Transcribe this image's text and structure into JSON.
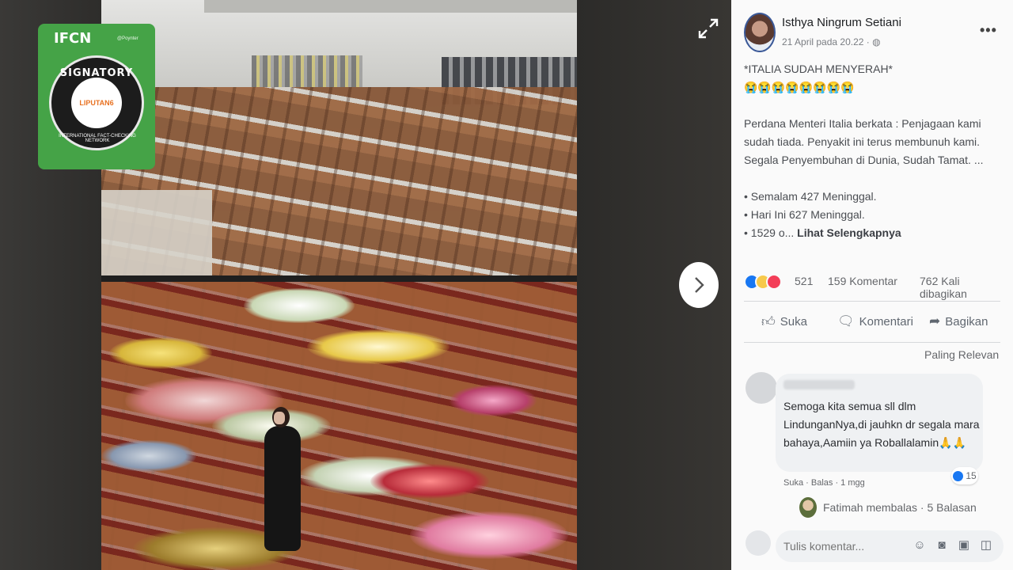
{
  "viewer": {
    "badge": {
      "logo": "IFCN",
      "logo_sub": "@Poynter",
      "signatory": "SIGNATORY",
      "network": "INTERNATIONAL FACT-CHECKING NETWORK",
      "brand": "LIPUTAN6"
    },
    "expand_icon": "expand-icon",
    "next_icon": "chevron-right-icon"
  },
  "post": {
    "author": "Isthya Ningrum Setiani",
    "timestamp": "21 April pada 20.22",
    "audience_icon": "globe-icon",
    "title": "*ITALIA SUDAH MENYERAH*",
    "emojis": "😭😭😭😭😭😭😭😭",
    "body_lines": [
      "Perdana Menteri Italia berkata : Penjagaan kami",
      "sudah tiada. Penyakit ini terus membunuh kami.",
      "Segala Penyembuhan di Dunia, Sudah Tamat. ..."
    ],
    "bullets": [
      "• Semalam 427 Meninggal.",
      "• Hari Ini 627 Meninggal.",
      "• 1529 o..."
    ],
    "see_more": "Lihat Selengkapnya",
    "reaction_count": "521",
    "comment_count": "159 Komentar",
    "share_count": "762 Kali dibagikan",
    "actions": {
      "like": "Suka",
      "comment": "Komentari",
      "share": "Bagikan"
    },
    "sort_label": "Paling Relevan"
  },
  "comment": {
    "text": "Semoga kita semua sll dlm LindunganNya,di jauhkn dr segala mara bahaya,Aamiin ya Roballalamin🙏🙏",
    "like_count": "15",
    "like_label": "Suka",
    "reply_label": "Balas",
    "age": "1 mgg",
    "reply_summary": "Fatimah membalas · 5 Balasan"
  },
  "composer": {
    "placeholder": "Tulis komentar..."
  },
  "colors": {
    "badge_green": "#45a347",
    "like_blue": "#1877f2",
    "love_red": "#f33e58"
  }
}
